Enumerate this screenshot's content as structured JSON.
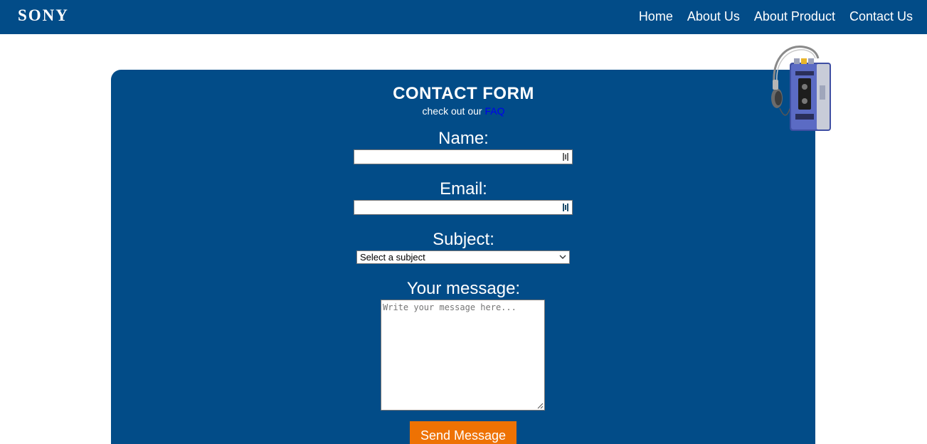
{
  "brand": {
    "logo_text": "SONY"
  },
  "nav": {
    "items": [
      {
        "label": "Home"
      },
      {
        "label": "About Us"
      },
      {
        "label": "About Product"
      },
      {
        "label": "Contact Us"
      }
    ]
  },
  "form": {
    "title": "CONTACT FORM",
    "faq_prefix": "check out our",
    "faq_link": "FAQ",
    "name_label": "Name:",
    "name_value": "",
    "email_label": "Email:",
    "email_value": "",
    "subject_label": "Subject:",
    "subject_selected": "Select a subject",
    "message_label": "Your message:",
    "message_placeholder": "Write your message here...",
    "send_label": "Send Message"
  },
  "product_image": {
    "icon": "walkman-cassette-player-image"
  },
  "colors": {
    "navbar": "#024c88",
    "panel": "#024c88",
    "button": "#ee7203",
    "faq_link": "#0000ee"
  }
}
